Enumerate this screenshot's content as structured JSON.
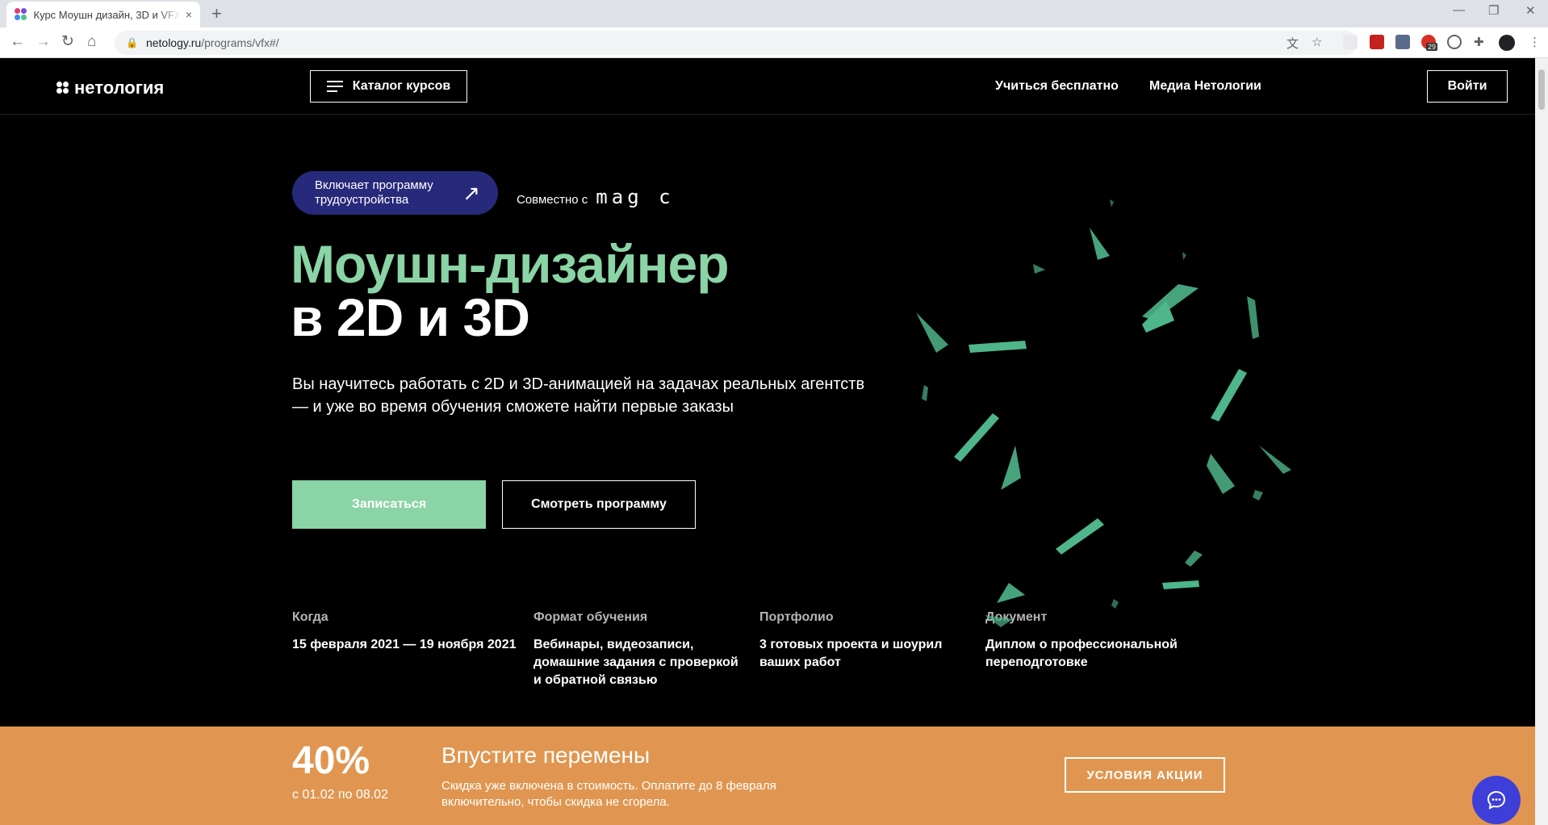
{
  "browser": {
    "tab_title": "Курс Моушн дизайн, 3D и VFX -",
    "tab_close": "×",
    "new_tab": "+",
    "url_domain": "netology.ru",
    "url_path": "/programs/vfx#/",
    "ext_badge": "29",
    "icons": [
      "back-icon",
      "forward-icon",
      "reload-icon",
      "home-icon",
      "lock-icon",
      "translate-icon",
      "star-icon",
      "eyedropper-icon",
      "pdf-icon",
      "extension-icon",
      "puzzle-icon",
      "avatar-icon",
      "menu-icon"
    ]
  },
  "header": {
    "logo_text": "нетология",
    "catalog_label": "Каталог курсов",
    "nav_free": "Учиться бесплатно",
    "nav_media": "Медиа Нетологии",
    "login_label": "Войти"
  },
  "hero": {
    "badge_text": "Включает программу трудоустройства",
    "joint_label": "Совместно с",
    "partner_logo": "mag c",
    "title_line1": "Моушн-дизайнер",
    "title_line2": "в 2D и 3D",
    "lead": "Вы научитесь работать с 2D и 3D-анимацией на задачах реальных агентств — и уже во время обучения сможете найти первые заказы",
    "cta_primary": "Записаться",
    "cta_secondary": "Смотреть программу"
  },
  "facts": [
    {
      "label": "Когда",
      "value": "15 февраля 2021 — 19 ноября 2021"
    },
    {
      "label": "Формат обучения",
      "value": "Вебинары, видеозаписи, домашние задания с проверкой и обратной связью"
    },
    {
      "label": "Портфолио",
      "value": "3 готовых проекта и шоурил ваших работ"
    },
    {
      "label": "Документ",
      "value": "Диплом о профессиональной переподготовке"
    }
  ],
  "promo": {
    "percent": "40%",
    "dates": "с 01.02 по 08.02",
    "title": "Впустите перемены",
    "text": "Скидка уже включена в стоимость. Оплатите до 8 февраля включительно, чтобы скидка не сгорела.",
    "button": "УСЛОВИЯ АКЦИИ"
  },
  "colors": {
    "accent_green": "#8ad4a5",
    "badge_navy": "#27297a",
    "promo_orange": "#e09650",
    "chat_blue": "#3d3fd8"
  }
}
